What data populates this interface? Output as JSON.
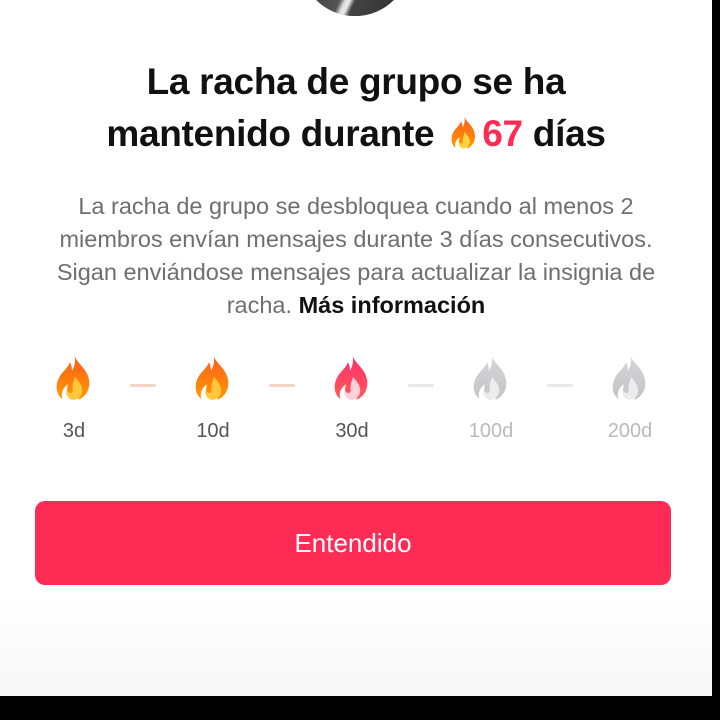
{
  "dialog": {
    "title_part1": "La racha de grupo se ha",
    "title_part2": "mantenido durante",
    "streak_count": "67",
    "title_part3": "días",
    "description": "La racha de grupo se desbloquea cuando al menos 2 miembros envían mensajes durante 3 días consecutivos. Sigan enviándose mensajes para actualizar la insignia de racha.",
    "more_link": "Más información",
    "confirm_button": "Entendido"
  },
  "milestones": [
    {
      "label": "3d",
      "state": "unlocked",
      "icon": "flame-orange-icon"
    },
    {
      "label": "10d",
      "state": "unlocked",
      "icon": "flame-orange-icon"
    },
    {
      "label": "30d",
      "state": "current",
      "icon": "flame-pink-icon"
    },
    {
      "label": "100d",
      "state": "locked",
      "icon": "flame-gray-icon"
    },
    {
      "label": "200d",
      "state": "locked",
      "icon": "flame-gray-icon"
    }
  ],
  "colors": {
    "accent": "#fe2c55",
    "flame_orange": "#ff8a00",
    "flame_yellow": "#ffc400",
    "flame_pink": "#ff3b6b",
    "flame_gray": "#cfcfd2"
  }
}
